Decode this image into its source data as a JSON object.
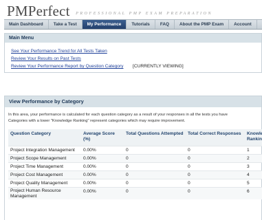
{
  "brand": {
    "name": "PMPerfect",
    "tagline": "PROFESSIONAL PMP EXAM PREPARATION"
  },
  "nav": {
    "tabs": [
      {
        "label": "Main Dashboard"
      },
      {
        "label": "Take a Test"
      },
      {
        "label": "My Performance"
      },
      {
        "label": "Tutorials"
      },
      {
        "label": "FAQ"
      },
      {
        "label": "About the PMP Exam"
      },
      {
        "label": "Account"
      }
    ],
    "active": "My Performance"
  },
  "main_menu": {
    "title": "Main Menu",
    "links": [
      "See Your Performance Trend for All Tests Taken",
      "Review Your Results on Past Tests",
      "Review Your Performance Report by Question Category"
    ],
    "current_marker": "[CURRENTLY VIEWING]"
  },
  "performance": {
    "title": "View Performance by Category",
    "intro_line1": "In this area, your performance is calculated for each question category as a result of your responses in all the tests you have",
    "intro_line2": "Categories with a lower \"Knowledge Ranking\" represent categories which may require improvement.",
    "columns": [
      "Question Category",
      "Average Score (%)",
      "Total Questions Attempted",
      "Total Correct Responses",
      "Knowledge Ranking"
    ],
    "rows": [
      {
        "category": "Project Integration Management",
        "avg": "0.00%",
        "attempted": "0",
        "correct": "0",
        "rank": "1"
      },
      {
        "category": "Project Scope Management",
        "avg": "0.00%",
        "attempted": "0",
        "correct": "0",
        "rank": "2"
      },
      {
        "category": "Project Time Management",
        "avg": "0.00%",
        "attempted": "0",
        "correct": "0",
        "rank": "3"
      },
      {
        "category": "Project Cost Management",
        "avg": "0.00%",
        "attempted": "0",
        "correct": "0",
        "rank": "4"
      },
      {
        "category": "Project Quality Management",
        "avg": "0.00%",
        "attempted": "0",
        "correct": "0",
        "rank": "5"
      },
      {
        "category": "Project Human Resource Management",
        "avg": "0.00%",
        "attempted": "0",
        "correct": "0",
        "rank": "6"
      }
    ]
  }
}
